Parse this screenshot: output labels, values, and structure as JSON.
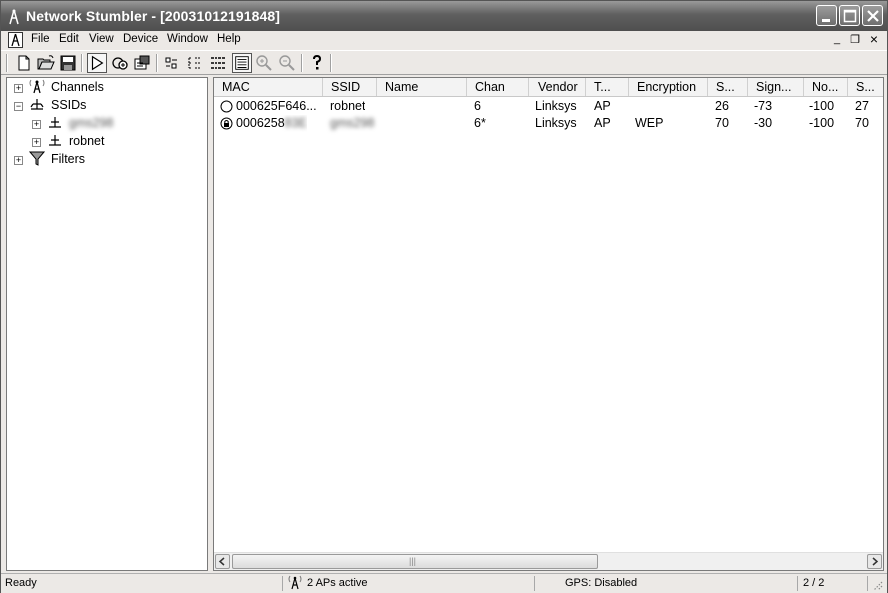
{
  "window": {
    "title": "Network Stumbler - [20031012191848]"
  },
  "menu": {
    "items": [
      "File",
      "Edit",
      "View",
      "Device",
      "Window",
      "Help"
    ],
    "mdi": {
      "minimize": "_",
      "restore": "❐",
      "close": "×"
    }
  },
  "toolbar": {
    "icons": [
      "new-file-icon",
      "open-folder-icon",
      "save-icon",
      "start-scan-icon",
      "auto-config-icon",
      "properties-icon",
      "large-icons-icon",
      "small-icons-icon",
      "list-view-icon",
      "details-view-icon",
      "zoom-in-icon",
      "zoom-out-icon",
      "help-icon"
    ]
  },
  "tree": {
    "channels": "Channels",
    "ssids": "SSIDs",
    "ssid_children": [
      "gms298",
      "robnet"
    ],
    "filters": "Filters"
  },
  "list": {
    "columns": [
      "MAC",
      "SSID",
      "Name",
      "Chan",
      "Vendor",
      "T...",
      "Encryption",
      "S...",
      "Sign...",
      "No...",
      "S..."
    ],
    "rows": [
      {
        "status_icon": "ap-open-icon",
        "mac": "000625F646...",
        "ssid": "robnet",
        "name": "",
        "chan": "6",
        "vendor": "Linksys",
        "type": "AP",
        "encryption": "",
        "snr": "26",
        "signal": "-73",
        "noise": "-100",
        "signal_plus": "27"
      },
      {
        "status_icon": "ap-locked-icon",
        "mac_prefix": "0006258",
        "mac_blurred": "83E",
        "ssid": "gms298",
        "name": "",
        "chan": "6*",
        "vendor": "Linksys",
        "type": "AP",
        "encryption": "WEP",
        "snr": "70",
        "signal": "-30",
        "noise": "-100",
        "signal_plus": "70"
      }
    ]
  },
  "scrollbar": {
    "grip": "|||"
  },
  "statusbar": {
    "ready": "Ready",
    "aps_active": "2 APs active",
    "gps": "GPS: Disabled",
    "count": "2 / 2"
  }
}
